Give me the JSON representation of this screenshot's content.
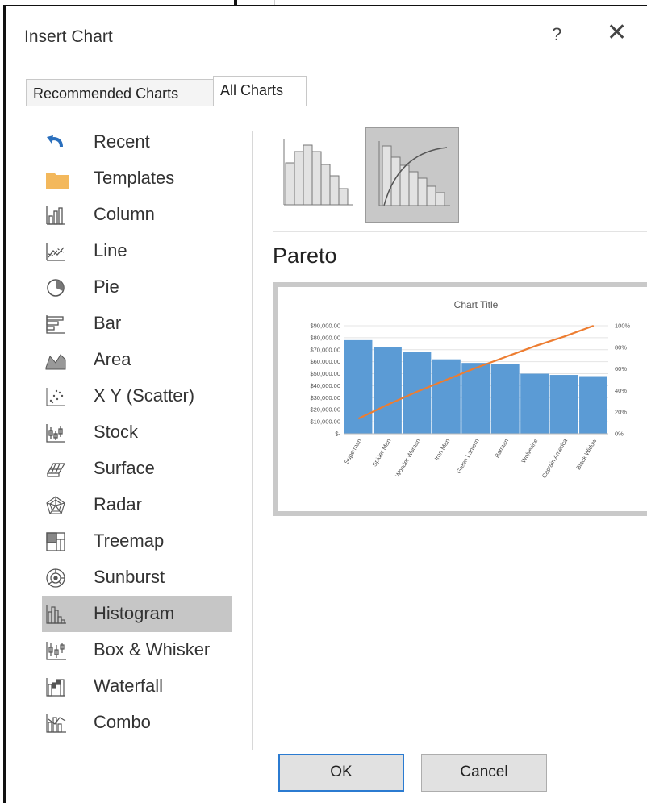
{
  "dialog": {
    "title": "Insert Chart",
    "help": "?",
    "close": "✕"
  },
  "tabs": [
    {
      "label": "Recommended Charts",
      "active": false
    },
    {
      "label": "All Charts",
      "active": true
    }
  ],
  "sidebar": {
    "items": [
      {
        "label": "Recent",
        "icon": "undo-arrow-icon"
      },
      {
        "label": "Templates",
        "icon": "folder-icon"
      },
      {
        "label": "Column",
        "icon": "column-chart-icon"
      },
      {
        "label": "Line",
        "icon": "line-chart-icon"
      },
      {
        "label": "Pie",
        "icon": "pie-chart-icon"
      },
      {
        "label": "Bar",
        "icon": "bar-chart-icon"
      },
      {
        "label": "Area",
        "icon": "area-chart-icon"
      },
      {
        "label": "X Y (Scatter)",
        "icon": "scatter-chart-icon"
      },
      {
        "label": "Stock",
        "icon": "stock-chart-icon"
      },
      {
        "label": "Surface",
        "icon": "surface-chart-icon"
      },
      {
        "label": "Radar",
        "icon": "radar-chart-icon"
      },
      {
        "label": "Treemap",
        "icon": "treemap-chart-icon"
      },
      {
        "label": "Sunburst",
        "icon": "sunburst-chart-icon"
      },
      {
        "label": "Histogram",
        "icon": "histogram-chart-icon",
        "selected": true
      },
      {
        "label": "Box & Whisker",
        "icon": "box-whisker-chart-icon"
      },
      {
        "label": "Waterfall",
        "icon": "waterfall-chart-icon"
      },
      {
        "label": "Combo",
        "icon": "combo-chart-icon"
      }
    ]
  },
  "subtypes": [
    {
      "icon": "histogram-subtype-icon",
      "selected": false
    },
    {
      "icon": "pareto-subtype-icon",
      "selected": true
    }
  ],
  "preview": {
    "name": "Pareto"
  },
  "chart_data": {
    "type": "bar",
    "title": "Chart Title",
    "categories": [
      "Superman",
      "Spider Man",
      "Wonder Woman",
      "Iron Man",
      "Green Lantern",
      "Batman",
      "Wolverine",
      "Captain America",
      "Black Widow"
    ],
    "series": [
      {
        "type": "bar",
        "values": [
          78000,
          72000,
          68000,
          62000,
          59000,
          58000,
          50000,
          49000,
          48000
        ],
        "color": "#5b9bd5"
      },
      {
        "type": "line",
        "axis": "right",
        "values": [
          14,
          27,
          39,
          50,
          61,
          71,
          81,
          90,
          100
        ],
        "color": "#ed7d31"
      }
    ],
    "ylim": [
      0,
      90000
    ],
    "y2lim": [
      0,
      100
    ],
    "yticks": [
      "$-",
      "$10,000.00",
      "$20,000.00",
      "$30,000.00",
      "$40,000.00",
      "$50,000.00",
      "$60,000.00",
      "$70,000.00",
      "$80,000.00",
      "$90,000.00"
    ],
    "y2ticks": [
      "0%",
      "20%",
      "40%",
      "60%",
      "80%",
      "100%"
    ],
    "grid": true
  },
  "buttons": {
    "ok": "OK",
    "cancel": "Cancel"
  }
}
